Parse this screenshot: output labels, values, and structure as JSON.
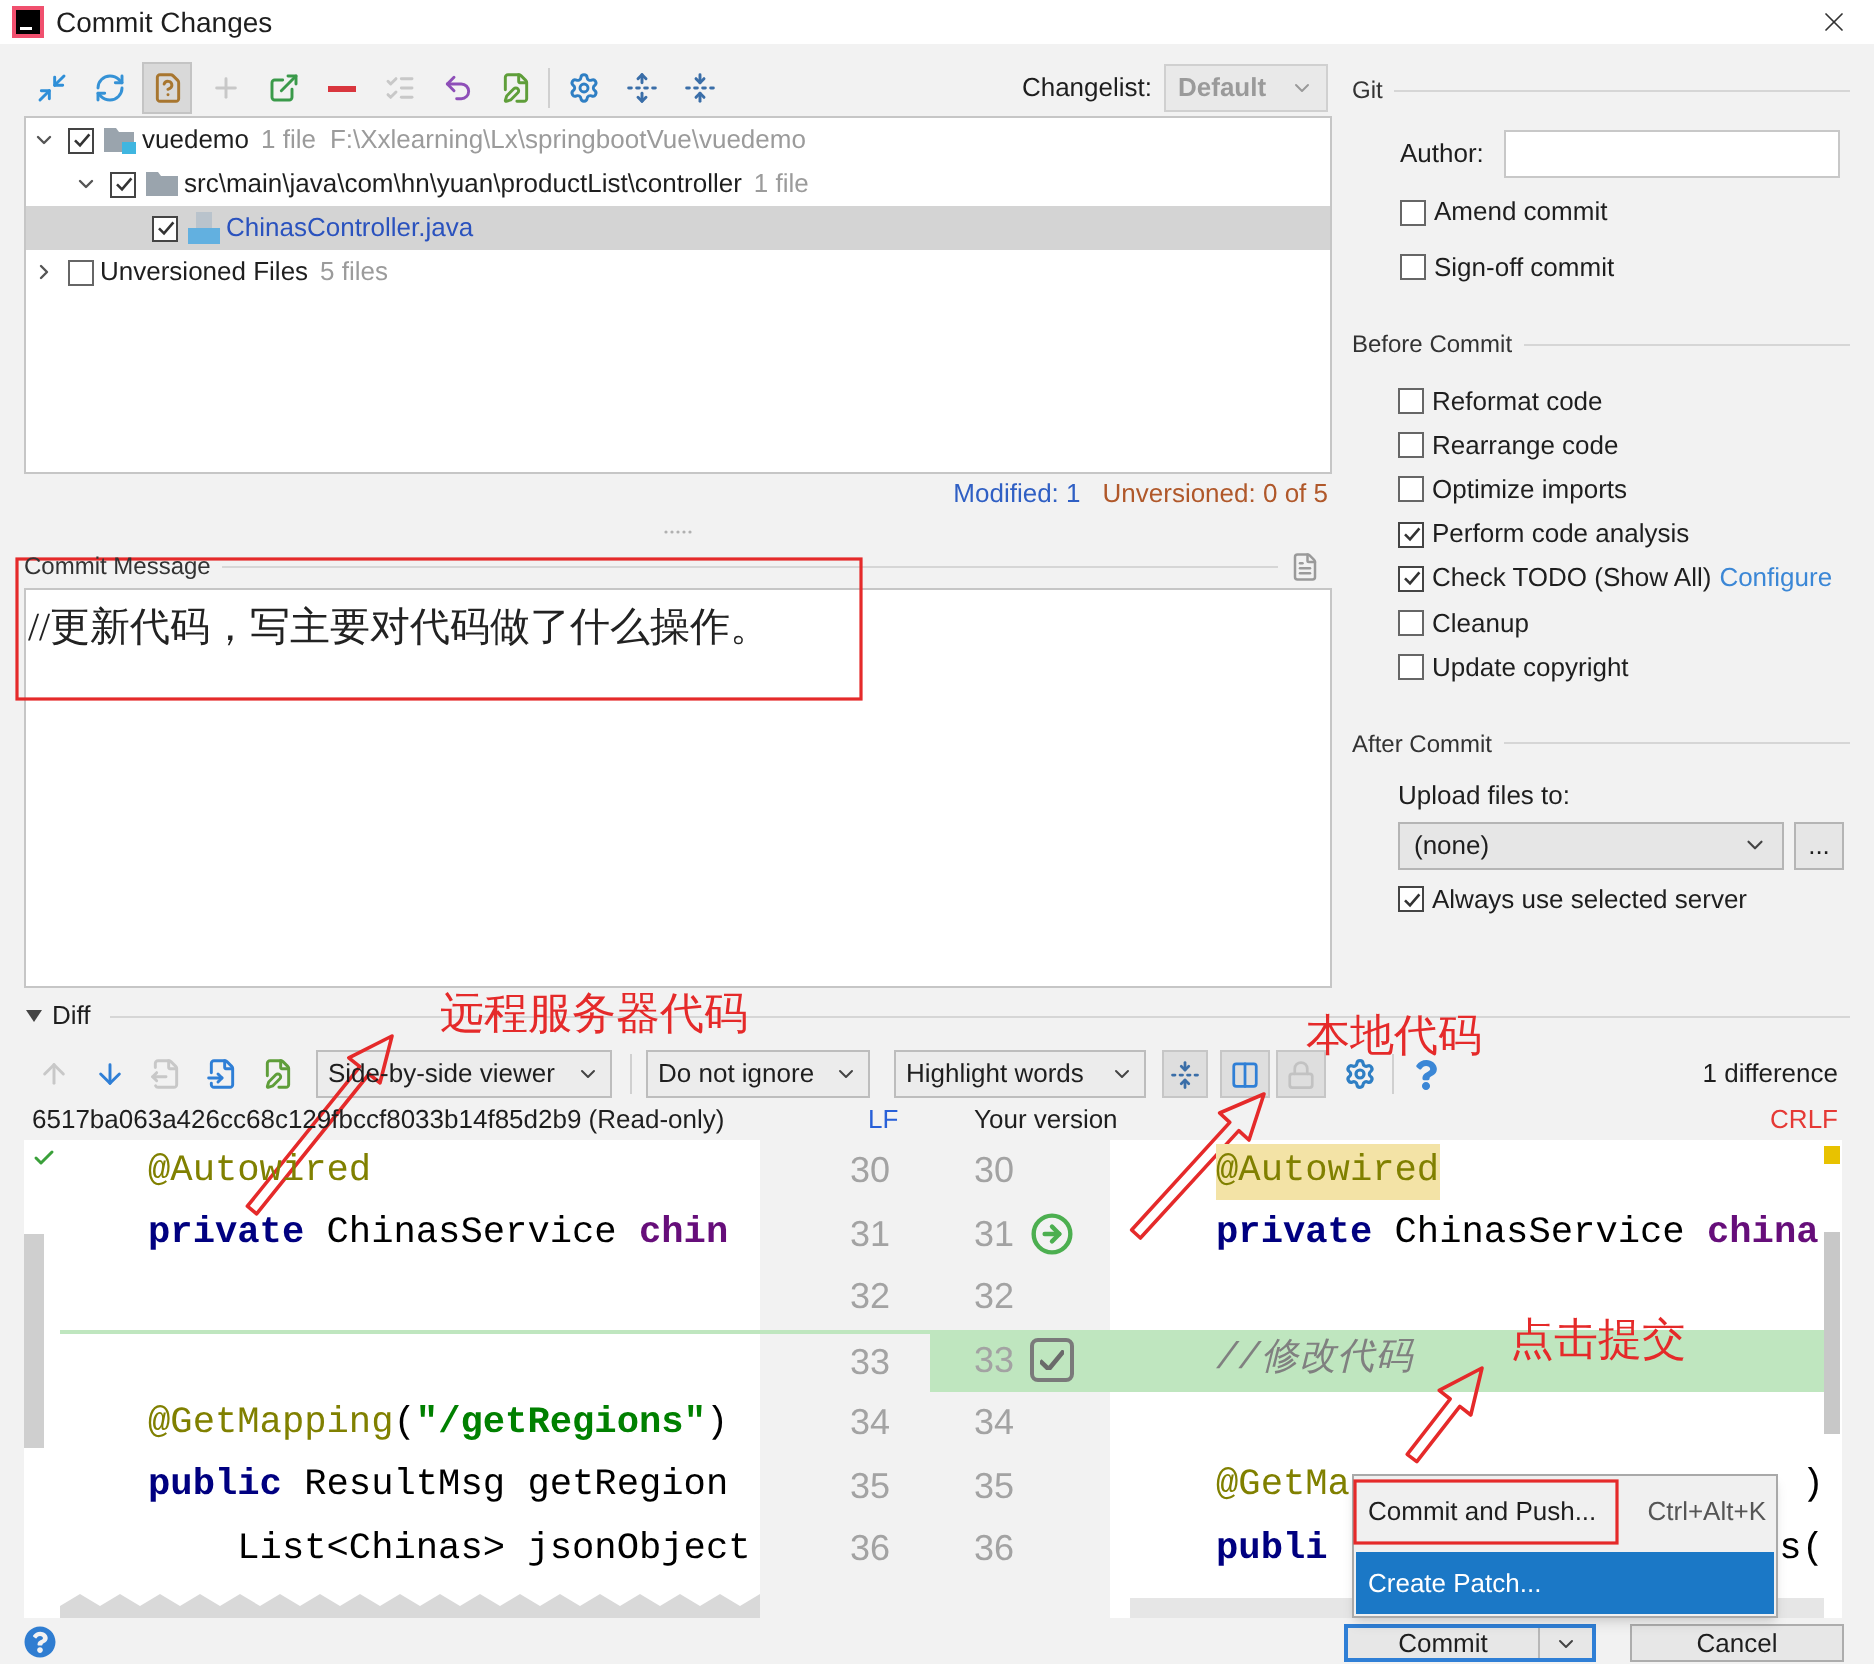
{
  "window": {
    "title": "Commit Changes"
  },
  "toolbar": [
    {
      "pressed": false,
      "disabled": false
    },
    {
      "pressed": false,
      "disabled": false
    },
    {
      "pressed": true,
      "disabled": false
    },
    {
      "pressed": false,
      "disabled": true
    },
    {
      "pressed": false,
      "disabled": false
    },
    {
      "pressed": false,
      "disabled": false
    },
    {
      "pressed": false,
      "disabled": true
    },
    {
      "pressed": false,
      "disabled": false
    },
    {
      "pressed": false,
      "disabled": false
    },
    {
      "pressed": false,
      "disabled": false
    },
    {
      "pressed": false,
      "disabled": false
    },
    {
      "pressed": false,
      "disabled": false
    }
  ],
  "changelist": {
    "label": "Changelist:",
    "value": "Default",
    "disabled": true
  },
  "changes_tree": [
    {
      "kind": "module",
      "name": "vuedemo",
      "count": "1 file",
      "path": "F:\\Xxlearning\\Lx\\springbootVue\\vuedemo",
      "checked": true,
      "expanded": true,
      "selected": false,
      "children": [
        {
          "kind": "folder",
          "name": "src\\main\\java\\com\\hn\\yuan\\productList\\controller",
          "count": "1 file",
          "checked": true,
          "expanded": true,
          "selected": false,
          "children": [
            {
              "kind": "file",
              "name": "ChinasController.java",
              "checked": true,
              "selected": true
            }
          ]
        }
      ]
    },
    {
      "kind": "group",
      "name": "Unversioned Files",
      "count": "5 files",
      "checked": false,
      "expanded": false,
      "selected": false
    }
  ],
  "summary": {
    "modified": "Modified: 1",
    "unversioned": "Unversioned: 0 of 5"
  },
  "commit_message": {
    "label": "Commit Message",
    "value": "//更新代码，写主要对代码做了什么操作。"
  },
  "git": {
    "title": "Git",
    "author_label": "Author:",
    "options": [
      {
        "label": "Amend commit",
        "checked": false
      },
      {
        "label": "Sign-off commit",
        "checked": false
      }
    ]
  },
  "before_commit": {
    "title": "Before Commit",
    "options": [
      {
        "label": "Reformat code",
        "checked": false
      },
      {
        "label": "Rearrange code",
        "checked": false
      },
      {
        "label": "Optimize imports",
        "checked": false
      },
      {
        "label": "Perform code analysis",
        "checked": true
      },
      {
        "label": "Check TODO (Show All)",
        "checked": true,
        "link": "Configure"
      },
      {
        "label": "Cleanup",
        "checked": false
      },
      {
        "label": "Update copyright",
        "checked": false
      }
    ]
  },
  "after_commit": {
    "title": "After Commit",
    "upload_label": "Upload files to:",
    "upload_value": "(none)",
    "browse_button": "...",
    "options": [
      {
        "label": "Always use selected server",
        "checked": true
      }
    ]
  },
  "diff": {
    "title": "Diff",
    "expanded": true,
    "toolbar": [
      {
        "disabled": true
      },
      {
        "disabled": false
      },
      {
        "disabled": true
      },
      {
        "disabled": false
      },
      {
        "disabled": false
      }
    ],
    "viewer": "Side-by-side viewer",
    "ignore": "Do not ignore",
    "highlight": "Highlight words",
    "toggles": [
      {
        "pressed": true,
        "disabled": false
      },
      {
        "pressed": true,
        "disabled": false
      },
      {
        "pressed": true,
        "disabled": true
      }
    ],
    "difference_count": "1 difference",
    "left_title": "6517ba063a426cc68c129fbccf8033b14f85d2b9 (Read-only)",
    "left_separator": "LF",
    "right_title": "Your version",
    "right_separator": "CRLF",
    "rows": [
      {
        "left_number": "30",
        "right_number": "30",
        "inserted": false,
        "left": [
          {
            "kind": "annotation",
            "text": "@Autowired"
          }
        ],
        "right": {
          "tokens": [
            {
              "kind": "annotation",
              "text": "@Autowired"
            }
          ],
          "highlighted": true
        }
      },
      {
        "left_number": "31",
        "right_number": "31",
        "inserted": false,
        "left": [
          {
            "kind": "keyword",
            "text": "private"
          },
          {
            "kind": "plain",
            "text": " ChinasService "
          },
          {
            "kind": "field",
            "text": "chin"
          }
        ],
        "right": {
          "tokens": [
            {
              "kind": "keyword",
              "text": "private"
            },
            {
              "kind": "plain",
              "text": " ChinasService "
            },
            {
              "kind": "field",
              "text": "china"
            }
          ],
          "highlighted": false
        },
        "gutter": {
          "kind": "apply"
        }
      },
      {
        "left_number": "32",
        "right_number": "32",
        "inserted": false
      },
      {
        "left_number": "33",
        "right_number": "33",
        "inserted": true,
        "right": {
          "tokens": [
            {
              "kind": "comment",
              "text": "//修改代码"
            }
          ],
          "highlighted": false
        },
        "gutter": {
          "kind": "checkbox",
          "checked": true
        }
      },
      {
        "left_number": "34",
        "right_number": "34",
        "inserted": false,
        "left": [
          {
            "kind": "annotation",
            "text": "@GetMapping"
          },
          {
            "kind": "plain",
            "text": "("
          },
          {
            "kind": "string",
            "text": "\"/getRegions\""
          },
          {
            "kind": "plain",
            "text": ")"
          }
        ]
      },
      {
        "left_number": "35",
        "right_number": "35",
        "inserted": false,
        "left": [
          {
            "kind": "keyword",
            "text": "public"
          },
          {
            "kind": "plain",
            "text": " ResultMsg getRegion"
          }
        ],
        "right": {
          "tokens": [
            {
              "kind": "annotation",
              "text": "@GetMa"
            }
          ],
          "highlighted": false,
          "tail": ")"
        }
      },
      {
        "left_number": "36",
        "right_number": "36",
        "inserted": false,
        "left": [
          {
            "kind": "plain",
            "text": "    List<Chinas> jsonObject"
          }
        ],
        "right": {
          "tokens": [
            {
              "kind": "keyword",
              "text": "publi"
            }
          ],
          "highlighted": false,
          "tail": "s("
        }
      }
    ]
  },
  "popup_menu": [
    {
      "label": "Commit and Push...",
      "shortcut": "Ctrl+Alt+K",
      "selected": false
    },
    {
      "label": "Create Patch...",
      "selected": true
    }
  ],
  "buttons": [
    {
      "kind": "split",
      "label": "Commit",
      "default": true
    },
    {
      "kind": "plain",
      "label": "Cancel",
      "default": false
    }
  ],
  "annotations": [
    {
      "text": "远程服务器代码"
    },
    {
      "text": "本地代码"
    },
    {
      "text": "点击提交"
    }
  ]
}
